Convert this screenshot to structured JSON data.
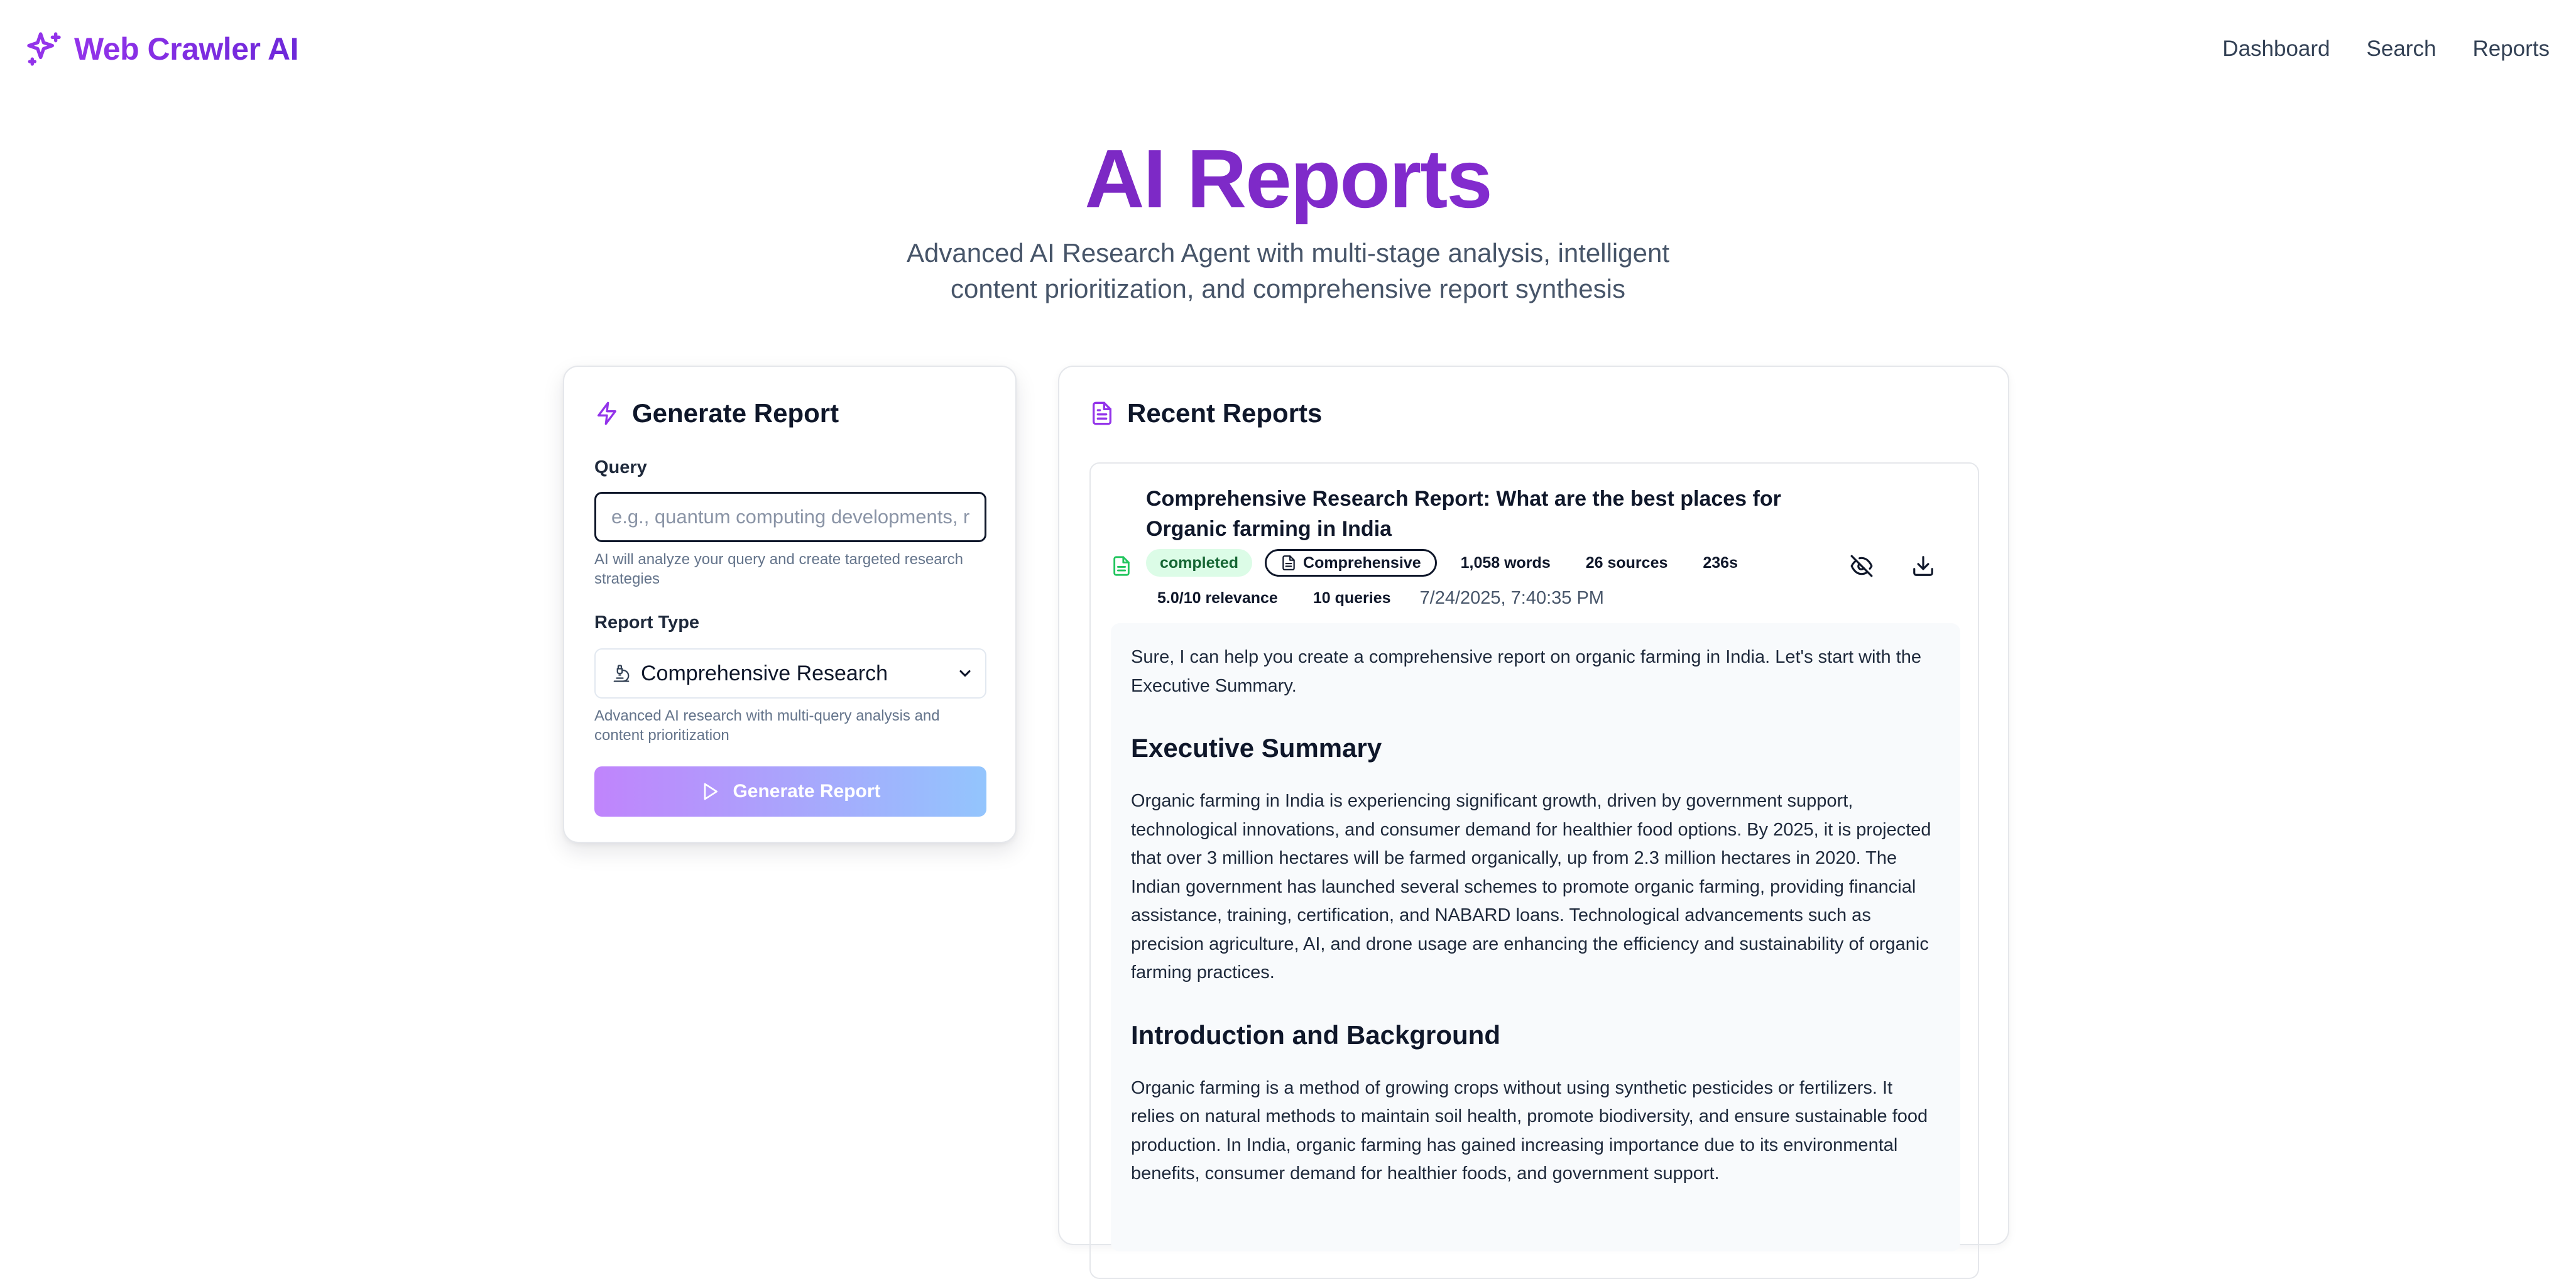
{
  "header": {
    "brand": "Web Crawler AI",
    "brand_icon": "sparkles-icon",
    "nav": [
      "Dashboard",
      "Search",
      "Reports"
    ]
  },
  "hero": {
    "title": "AI Reports",
    "subtitle_line1": "Advanced AI Research Agent with multi-stage analysis, intelligent",
    "subtitle_line2": "content prioritization, and comprehensive report synthesis"
  },
  "generate": {
    "title": "Generate Report",
    "title_icon": "zap-icon",
    "query_label": "Query",
    "query_placeholder": "e.g., quantum computing developments, renewable energy",
    "query_value": "",
    "query_hint": "AI will analyze your query and create targeted research strategies",
    "type_label": "Report Type",
    "type_value": "Comprehensive Research",
    "type_icon": "microscope-icon",
    "type_hint": "Advanced AI research with multi-query analysis and content prioritization",
    "button_label": "Generate Report",
    "button_icon": "play-icon"
  },
  "recent": {
    "title": "Recent Reports",
    "title_icon": "file-text-icon",
    "report": {
      "title": "Comprehensive Research Report: What are the best places for Organic farming in India",
      "status": "completed",
      "type": "Comprehensive",
      "words": "1,058 words",
      "sources": "26 sources",
      "duration": "236s",
      "relevance": "5.0/10 relevance",
      "queries": "10 queries",
      "date": "7/24/2025, 7:40:35 PM",
      "intro": "Sure, I can help you create a comprehensive report on organic farming in India. Let's start with the Executive Summary.",
      "section1_title": "Executive Summary",
      "section1_body": "Organic farming in India is experiencing significant growth, driven by government support, technological innovations, and consumer demand for healthier food options. By 2025, it is projected that over 3 million hectares will be farmed organically, up from 2.3 million hectares in 2020. The Indian government has launched several schemes to promote organic farming, providing financial assistance, training, certification, and NABARD loans. Technological advancements such as precision agriculture, AI, and drone usage are enhancing the efficiency and sustainability of organic farming practices.",
      "section2_title": "Introduction and Background",
      "section2_body": "Organic farming is a method of growing crops without using synthetic pesticides or fertilizers. It relies on natural methods to maintain soil health, promote biodiversity, and ensure sustainable food production. In India, organic farming has gained increasing importance due to its environmental benefits, consumer demand for healthier foods, and government support."
    }
  },
  "colors": {
    "brand": "#7e22ce",
    "status_green": "#22c55e",
    "button_gradient_start": "#c084fc",
    "button_gradient_end": "#93c5fd"
  }
}
